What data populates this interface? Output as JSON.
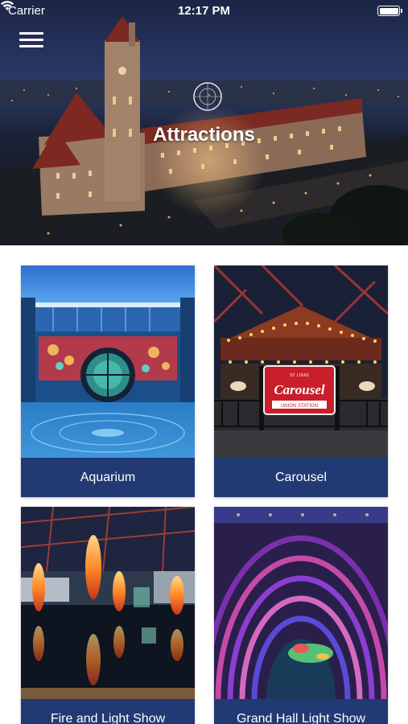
{
  "status_bar": {
    "carrier": "Carrier",
    "time": "12:17 PM",
    "icons": [
      "wifi-icon",
      "battery-icon"
    ]
  },
  "header": {
    "title": "Attractions",
    "menu_icon": "hamburger-menu-icon"
  },
  "attractions": [
    {
      "label": "Aquarium"
    },
    {
      "label": "Carousel"
    },
    {
      "label": "Fire and Light Show"
    },
    {
      "label": "Grand Hall Light Show"
    }
  ],
  "colors": {
    "caption_background": "#223a73",
    "caption_text": "#ffffff",
    "page_background": "#ffffff"
  }
}
